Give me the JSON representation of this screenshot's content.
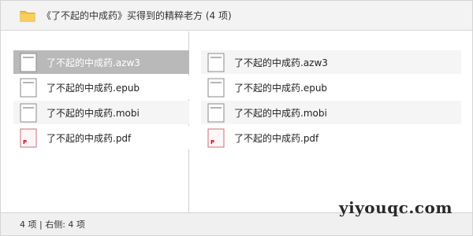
{
  "window": {
    "title": "《了不起的中成药》买得到的精粹老方 (4 项)",
    "folder_icon": "folder-icon",
    "accent": "#f5c242"
  },
  "left_pane": {
    "files": [
      {
        "label": "了不起的中成药.azw3",
        "icon": "document-icon",
        "state": "selected"
      },
      {
        "label": "了不起的中成药.epub",
        "icon": "document-icon",
        "state": "plain"
      },
      {
        "label": "了不起的中成药.mobi",
        "icon": "document-icon",
        "state": "shaded"
      },
      {
        "label": "了不起的中成药.pdf",
        "icon": "pdf-icon",
        "state": "plain"
      }
    ]
  },
  "right_pane": {
    "files": [
      {
        "label": "了不起的中成药.azw3",
        "icon": "document-icon",
        "state": "shaded"
      },
      {
        "label": "了不起的中成药.epub",
        "icon": "document-icon",
        "state": "plain"
      },
      {
        "label": "了不起的中成药.mobi",
        "icon": "document-icon",
        "state": "shaded"
      },
      {
        "label": "了不起的中成药.pdf",
        "icon": "pdf-icon",
        "state": "plain"
      }
    ]
  },
  "status": {
    "text": "4 项 | 右侧: 4 项"
  },
  "watermark": {
    "text": "yiyouqc.com"
  },
  "colors": {
    "selected_row": "#b9b9b9",
    "shaded_row": "#f5f5f5",
    "pdf_red": "#d0021b"
  }
}
